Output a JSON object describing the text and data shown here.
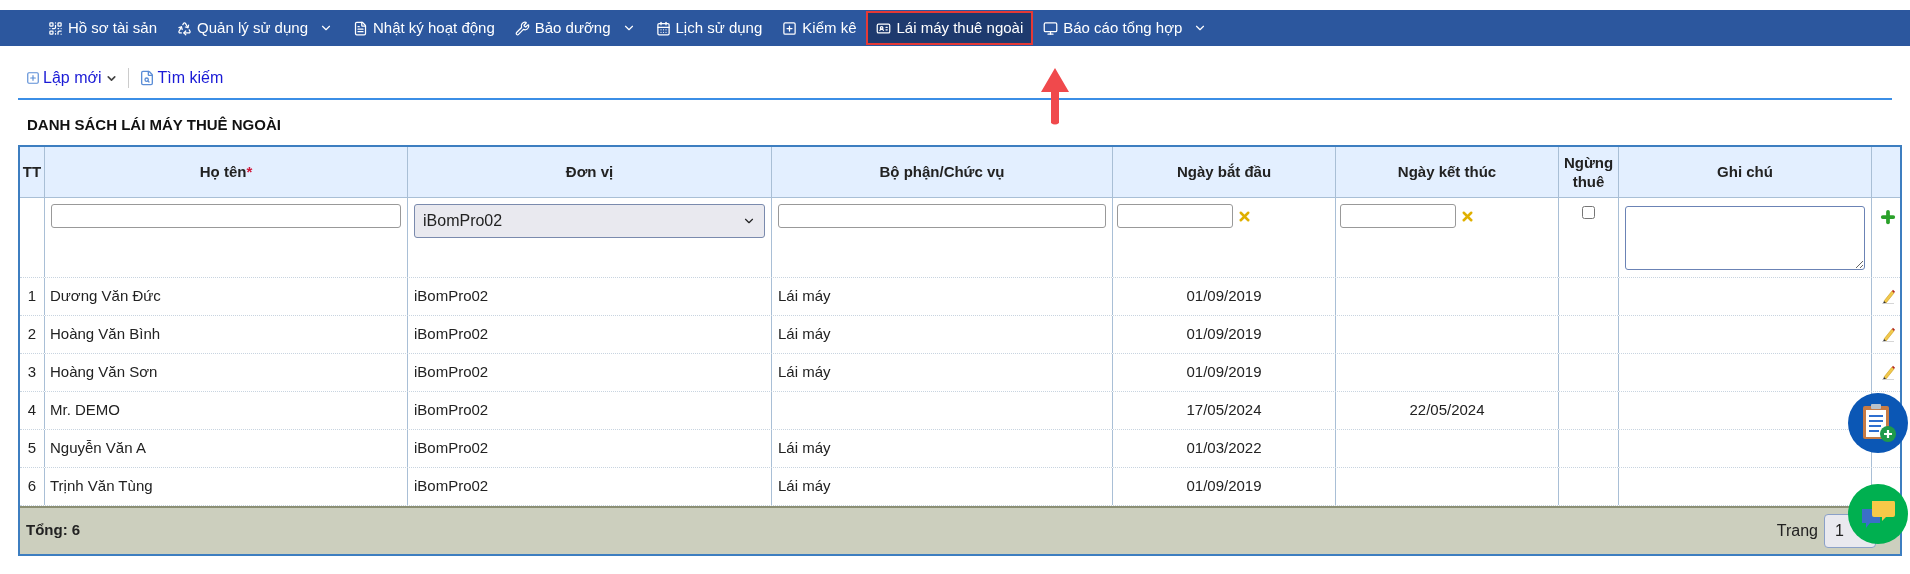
{
  "nav": {
    "items": [
      {
        "label": "Hồ sơ tài sản",
        "has_dropdown": false,
        "selected": false
      },
      {
        "label": "Quản lý sử dụng",
        "has_dropdown": true,
        "selected": false
      },
      {
        "label": "Nhật ký hoạt động",
        "has_dropdown": false,
        "selected": false
      },
      {
        "label": "Bảo dưỡng",
        "has_dropdown": true,
        "selected": false
      },
      {
        "label": "Lịch sử dụng",
        "has_dropdown": false,
        "selected": false
      },
      {
        "label": "Kiểm kê",
        "has_dropdown": false,
        "selected": false
      },
      {
        "label": "Lái máy thuê ngoài",
        "has_dropdown": false,
        "selected": true
      },
      {
        "label": "Báo cáo tổng hợp",
        "has_dropdown": true,
        "selected": false
      }
    ]
  },
  "toolbar": {
    "new_button": "Lập mới",
    "search_button": "Tìm kiếm"
  },
  "title": "DANH SÁCH LÁI MÁY THUÊ NGOÀI",
  "table": {
    "columns": [
      {
        "label": "TT"
      },
      {
        "label": "Họ tên",
        "mark": "*"
      },
      {
        "label": "Đơn vị"
      },
      {
        "label": "Bộ phận/Chức vụ"
      },
      {
        "label": "Ngày bắt đầu"
      },
      {
        "label": "Ngày kết thúc"
      },
      {
        "label": "Ngừng thuê"
      },
      {
        "label": "Ghi chú"
      }
    ],
    "filter": {
      "unit_value": "iBomPro02",
      "stopped_checked": false
    },
    "rows": [
      {
        "tt": "1",
        "name": "Dương Văn Đức",
        "unit": "iBomPro02",
        "position": "Lái máy",
        "start": "01/09/2019",
        "end": "",
        "edit_icon": true
      },
      {
        "tt": "2",
        "name": "Hoàng Văn Bình",
        "unit": "iBomPro02",
        "position": "Lái máy",
        "start": "01/09/2019",
        "end": "",
        "edit_icon": true
      },
      {
        "tt": "3",
        "name": "Hoàng Văn Sơn",
        "unit": "iBomPro02",
        "position": "Lái máy",
        "start": "01/09/2019",
        "end": "",
        "edit_icon": true
      },
      {
        "tt": "4",
        "name": "Mr. DEMO",
        "unit": "iBomPro02",
        "position": "",
        "start": "17/05/2024",
        "end": "22/05/2024",
        "edit_icon": false
      },
      {
        "tt": "5",
        "name": "Nguyễn Văn A",
        "unit": "iBomPro02",
        "position": "Lái máy",
        "start": "01/03/2022",
        "end": "",
        "edit_icon": false
      },
      {
        "tt": "6",
        "name": "Trịnh Văn Tùng",
        "unit": "iBomPro02",
        "position": "Lái máy",
        "start": "01/09/2019",
        "end": "",
        "edit_icon": false
      }
    ],
    "footer": {
      "total": "Tổng: 6",
      "page_label": "Trang",
      "page_value": "1"
    }
  }
}
